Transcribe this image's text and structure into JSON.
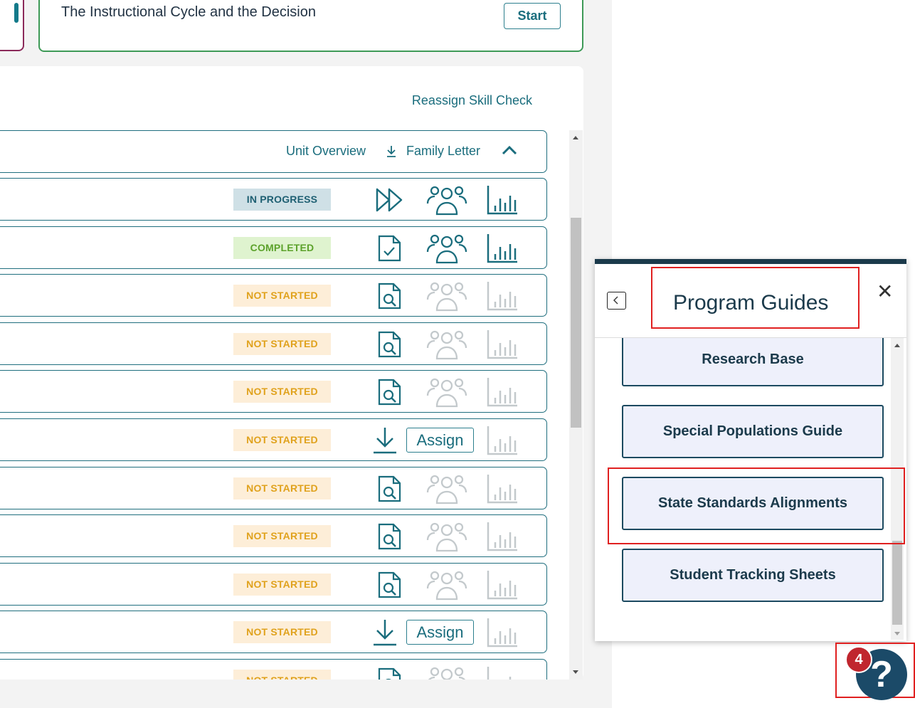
{
  "lesson_card": {
    "title": "The Instructional Cycle and the Decision",
    "start_label": "Start"
  },
  "panel": {
    "reassign_label": "Reassign Skill Check",
    "unit_overview_label": "Unit Overview",
    "family_letter_label": "Family Letter",
    "rows": [
      {
        "status": "IN PROGRESS",
        "kind": "progress",
        "action": "fast-forward-icon"
      },
      {
        "status": "COMPLETED",
        "kind": "completed",
        "action": "document-check-icon"
      },
      {
        "status": "NOT STARTED",
        "kind": "notstarted",
        "action": "document-search-icon"
      },
      {
        "status": "NOT STARTED",
        "kind": "notstarted",
        "action": "document-search-icon"
      },
      {
        "status": "NOT STARTED",
        "kind": "notstarted",
        "action": "document-search-icon"
      },
      {
        "status": "NOT STARTED",
        "kind": "notstarted",
        "action": "download-assign",
        "assign_label": "Assign"
      },
      {
        "status": "NOT STARTED",
        "kind": "notstarted",
        "action": "document-search-icon"
      },
      {
        "status": "NOT STARTED",
        "kind": "notstarted",
        "action": "document-search-icon"
      },
      {
        "status": "NOT STARTED",
        "kind": "notstarted",
        "action": "document-search-icon"
      },
      {
        "status": "NOT STARTED",
        "kind": "notstarted",
        "action": "download-assign",
        "assign_label": "Assign"
      },
      {
        "status": "NOT STARTED",
        "kind": "notstarted",
        "action": "document-search-icon"
      }
    ]
  },
  "program_guides": {
    "title": "Program Guides",
    "close_label": "✕",
    "items": [
      {
        "label": "Research Base"
      },
      {
        "label": "Special Populations Guide"
      },
      {
        "label": "State Standards Alignments"
      },
      {
        "label": "Student Tracking Sheets"
      }
    ]
  },
  "help": {
    "count": "4",
    "label": "?"
  },
  "colors": {
    "teal": "#1a6d7d",
    "navy": "#1b3a4b",
    "highlight": "#e02020"
  }
}
